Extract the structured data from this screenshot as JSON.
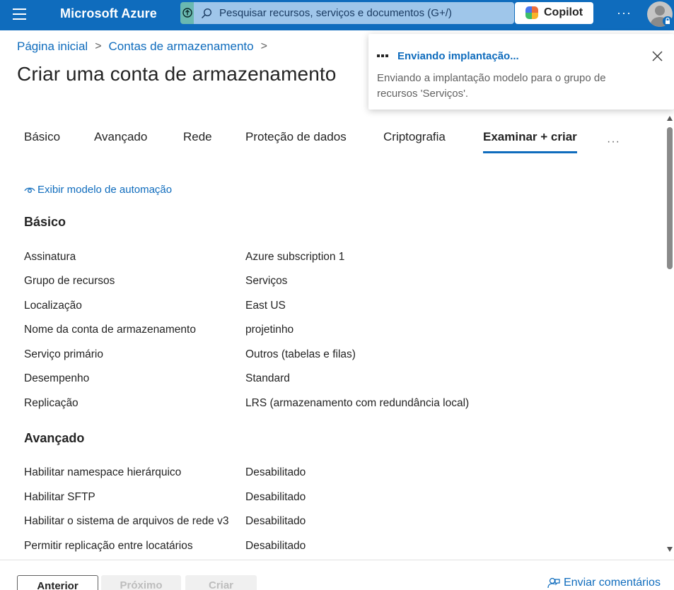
{
  "topbar": {
    "brand": "Microsoft Azure",
    "search_placeholder": "Pesquisar recursos, serviços e documentos (G+/)",
    "copilot_label": "Copilot",
    "more_label": "···",
    "accent": "#0f6cbd"
  },
  "breadcrumb": {
    "items": [
      "Página inicial",
      "Contas de armazenamento"
    ],
    "separator": ">"
  },
  "page": {
    "title": "Criar uma conta de armazenamento"
  },
  "tabs": {
    "items": [
      "Básico",
      "Avançado",
      "Rede",
      "Proteção de dados",
      "Criptografia",
      "Examinar + criar"
    ],
    "active": "Examinar + criar",
    "more_label": "···"
  },
  "automation_link": "Exibir modelo de automação",
  "sections": [
    {
      "title": "Básico",
      "rows": [
        {
          "label": "Assinatura",
          "value": "Azure subscription 1"
        },
        {
          "label": "Grupo de recursos",
          "value": "Serviços"
        },
        {
          "label": "Localização",
          "value": "East US"
        },
        {
          "label": "Nome da conta de armazenamento",
          "value": "projetinho"
        },
        {
          "label": "Serviço primário",
          "value": "Outros (tabelas e filas)"
        },
        {
          "label": "Desempenho",
          "value": "Standard"
        },
        {
          "label": "Replicação",
          "value": "LRS (armazenamento com redundância local)"
        }
      ]
    },
    {
      "title": "Avançado",
      "rows": [
        {
          "label": "Habilitar namespace hierárquico",
          "value": "Desabilitado"
        },
        {
          "label": "Habilitar SFTP",
          "value": "Desabilitado"
        },
        {
          "label": "Habilitar o sistema de arquivos de rede v3",
          "value": "Desabilitado"
        },
        {
          "label": "Permitir replicação entre locatários",
          "value": "Desabilitado"
        }
      ]
    }
  ],
  "notification": {
    "title": "Enviando implantação...",
    "body": "Enviando a implantação modelo para o grupo de recursos 'Serviços'."
  },
  "footer": {
    "previous_label": "Anterior",
    "next_label": "Próximo",
    "create_label": "Criar",
    "feedback_label": "Enviar comentários"
  }
}
